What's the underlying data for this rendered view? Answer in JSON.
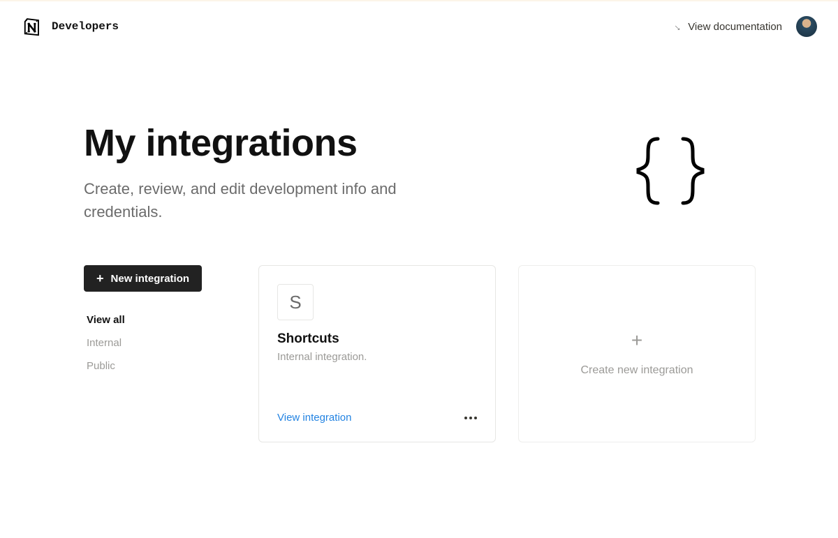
{
  "header": {
    "brand": "Developers",
    "doc_link": "View documentation"
  },
  "hero": {
    "title": "My integrations",
    "subtitle": "Create, review, and edit development info and credentials."
  },
  "sidebar": {
    "new_button": "New integration",
    "filters": {
      "view_all": "View all",
      "internal": "Internal",
      "public": "Public"
    }
  },
  "cards": {
    "integration": {
      "icon_letter": "S",
      "title": "Shortcuts",
      "subtitle": "Internal integration.",
      "view_link": "View integration"
    },
    "create": {
      "label": "Create new integration"
    }
  }
}
